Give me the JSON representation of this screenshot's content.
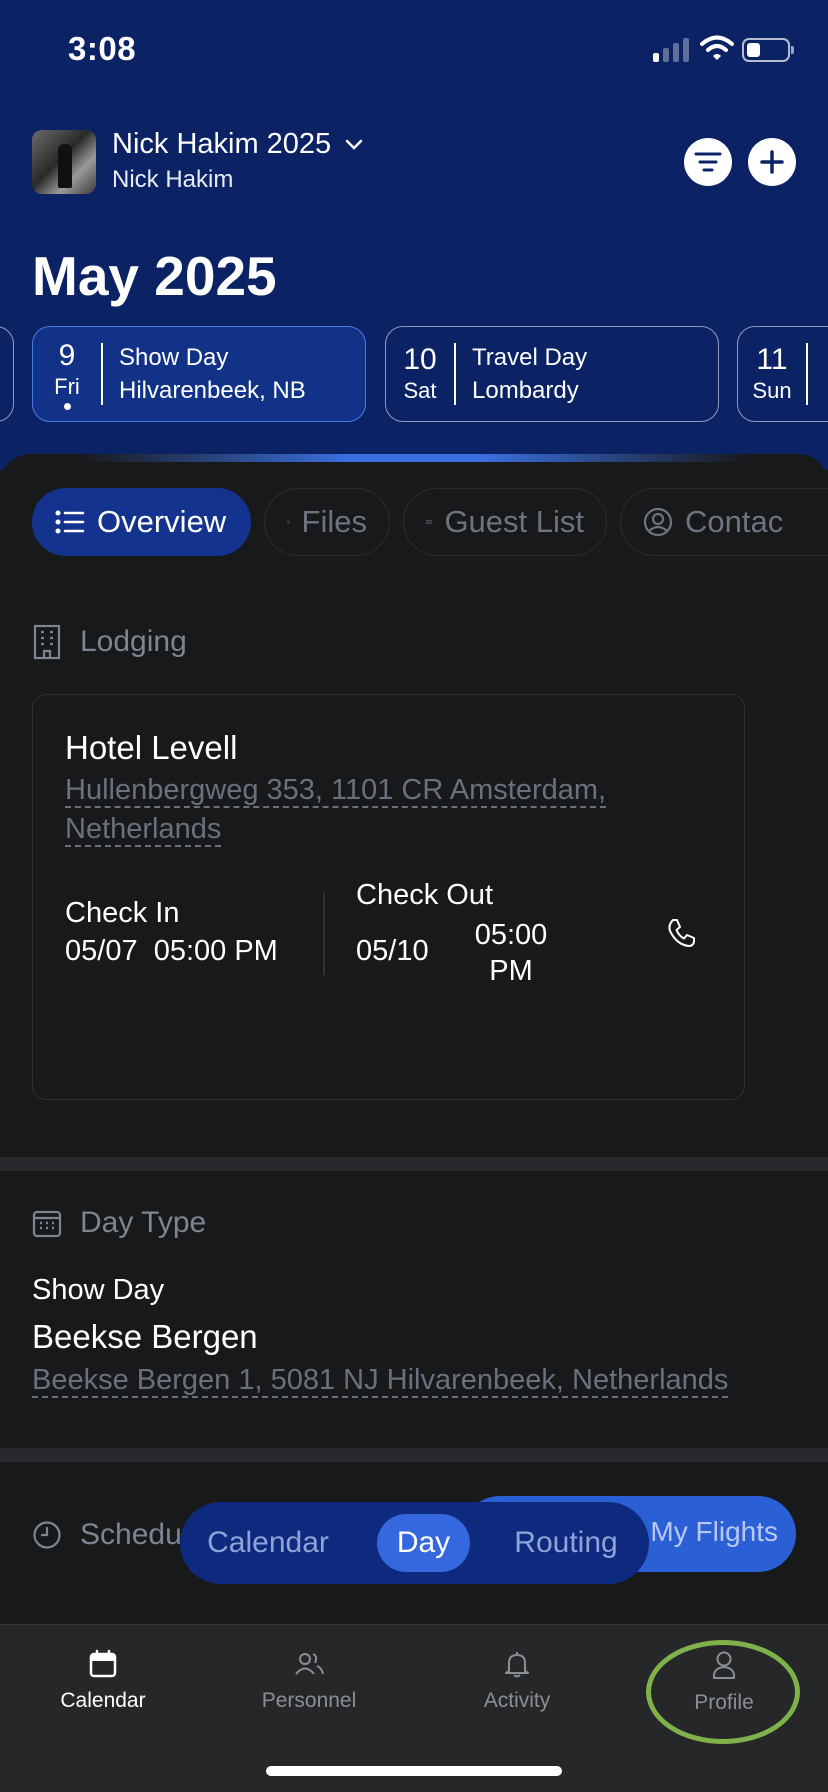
{
  "status": {
    "time": "3:08"
  },
  "header": {
    "project_title": "Nick Hakim 2025",
    "project_subtitle": "Nick Hakim",
    "month": "May 2025"
  },
  "days": [
    {
      "num": "9",
      "dow": "Fri",
      "type": "Show Day",
      "place": "Hilvarenbeek, NB",
      "active": true
    },
    {
      "num": "10",
      "dow": "Sat",
      "type": "Travel Day",
      "place": "Lombardy",
      "active": false
    },
    {
      "num": "11",
      "dow": "Sun",
      "type": "",
      "place": "",
      "active": false
    }
  ],
  "tabs": {
    "overview": "Overview",
    "files": "Files",
    "guest_list": "Guest List",
    "contacts": "Contac"
  },
  "lodging": {
    "heading": "Lodging",
    "hotel_name": "Hotel Levell",
    "address": "Hullenbergweg 353, 1101 CR Amsterdam, Netherlands",
    "check_in_label": "Check In",
    "check_in_date": "05/07",
    "check_in_time": "05:00 PM",
    "check_out_label": "Check Out",
    "check_out_date": "05/10",
    "check_out_time": "05:00 PM"
  },
  "day_type": {
    "heading": "Day Type",
    "type": "Show Day",
    "venue": "Beekse Bergen",
    "address": "Beekse Bergen 1, 5081 NJ Hilvarenbeek, Netherlands"
  },
  "schedule": {
    "heading": "Schedu"
  },
  "view_switch": {
    "calendar": "Calendar",
    "day": "Day",
    "routing": "Routing"
  },
  "my_flights": "My Flights",
  "nav": {
    "calendar": "Calendar",
    "personnel": "Personnel",
    "activity": "Activity",
    "profile": "Profile"
  },
  "colors": {
    "header_bg": "#0b2265",
    "accent": "#3568de",
    "panel_bg": "#18191b",
    "highlight_ring": "#7fb24a"
  }
}
